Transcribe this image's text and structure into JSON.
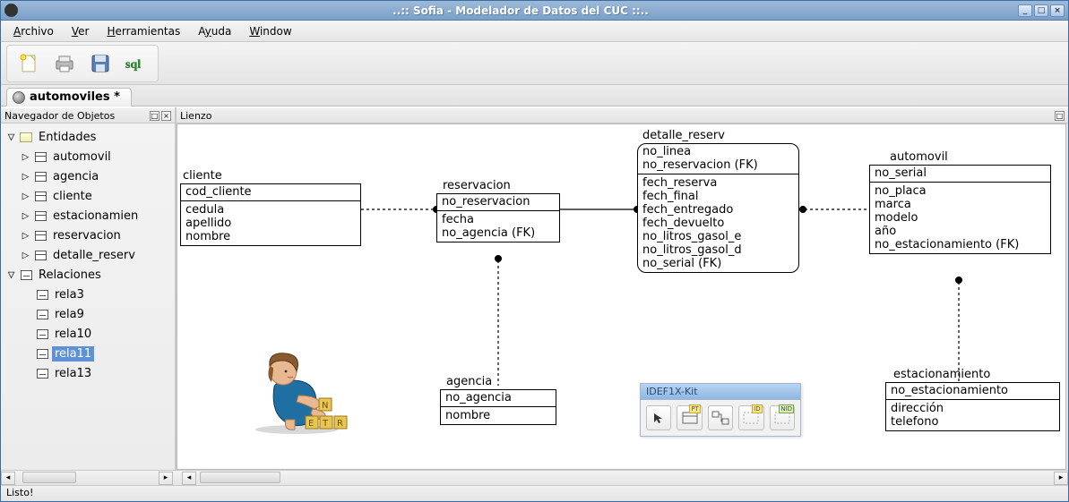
{
  "window": {
    "title": "..:: Sofia - Modelador de Datos del CUC ::.."
  },
  "menu": {
    "items": [
      "Archivo",
      "Ver",
      "Herramientas",
      "Ayuda",
      "Window"
    ]
  },
  "tab": {
    "label": "automoviles *"
  },
  "sidebar": {
    "title": "Navegador de Objetos",
    "entidades_label": "Entidades",
    "relaciones_label": "Relaciones",
    "entidades": [
      "automovil",
      "agencia",
      "cliente",
      "estacionamien",
      "reservacion",
      "detalle_reserv"
    ],
    "relaciones": [
      "rela3",
      "rela9",
      "rela10",
      "rela11",
      "rela13"
    ],
    "selected": "rela11"
  },
  "canvas": {
    "title": "Lienzo",
    "entities": {
      "cliente": {
        "name": "cliente",
        "keys": [
          "cod_cliente"
        ],
        "attrs": [
          "cedula",
          "apellido",
          "nombre"
        ]
      },
      "reservacion": {
        "name": "reservacion",
        "keys": [
          "no_reservacion"
        ],
        "attrs": [
          "fecha",
          "no_agencia (FK)"
        ]
      },
      "detalle_reserv": {
        "name": "detalle_reserv",
        "keys": [
          "no_linea",
          "no_reservacion (FK)"
        ],
        "attrs": [
          "fech_reserva",
          "fech_final",
          "fech_entregado",
          "fech_devuelto",
          "no_litros_gasol_e",
          "no_litros_gasol_d",
          "no_serial (FK)"
        ]
      },
      "automovil": {
        "name": "automovil",
        "keys": [
          "no_serial"
        ],
        "attrs": [
          "no_placa",
          "marca",
          "modelo",
          "año",
          "no_estacionamiento (FK)"
        ]
      },
      "agencia": {
        "name": "agencia",
        "keys": [
          "no_agencia"
        ],
        "attrs": [
          "nombre"
        ]
      },
      "estacionamiento": {
        "name": "estacionamiento",
        "keys": [
          "no_estacionamiento"
        ],
        "attrs": [
          "dirección",
          "telefono"
        ]
      }
    },
    "toolkit_title": "IDEF1X-Kit",
    "toolkit_buttons": [
      "pointer",
      "PT",
      "entity",
      "ID",
      "NID"
    ]
  },
  "status": "Listo!",
  "colors": {
    "titlebar": "#8eb0d3",
    "selection": "#5d93d6"
  }
}
